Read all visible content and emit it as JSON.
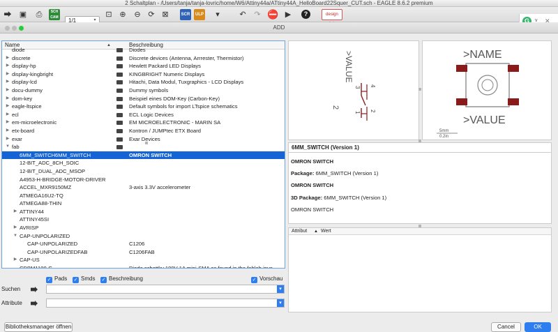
{
  "window_title": "2 Schaltplan - /Users/tanja/tanja-lovric/home/W6/Attiny44a/ATtiny44A_HelloBoard22Squer_CUT.sch - EAGLE 8.6.2 premium",
  "toolbar": {
    "sheet": "1/1",
    "icons": [
      "open-icon",
      "save-icon",
      "print-icon",
      "cam-icon",
      "sheet-select",
      "zoom-fit-icon",
      "zoom-in-icon",
      "zoom-out-icon",
      "zoom-redraw-icon",
      "zoom-select-icon",
      "scr-icon",
      "ulp-icon",
      "undo-icon",
      "redo-icon",
      "stop-icon",
      "go-icon",
      "help-icon",
      "eagle-logo"
    ],
    "brand_label": "design link",
    "version": "v"
  },
  "dialog": {
    "title": "ADD"
  },
  "tree": {
    "col_name": "Name",
    "col_desc": "Beschreibung",
    "rows": [
      {
        "name": "diode",
        "desc": "Diodes",
        "arrow": "",
        "lib": true,
        "indent": 0
      },
      {
        "name": "discrete",
        "desc": "Discrete devices (Antenna, Arrrester, Thermistor)",
        "arrow": "▶",
        "lib": true,
        "indent": 0
      },
      {
        "name": "display-hp",
        "desc": "Hewlett Packard LED Displays",
        "arrow": "▶",
        "lib": true,
        "indent": 0
      },
      {
        "name": "display-kingbright",
        "desc": "KINGBRIGHT Numeric Displays",
        "arrow": "▶",
        "lib": true,
        "indent": 0
      },
      {
        "name": "display-lcd",
        "desc": "Hitachi, Data Modul, Tuxgraphics - LCD Displays",
        "arrow": "▶",
        "lib": true,
        "indent": 0
      },
      {
        "name": "docu-dummy",
        "desc": "Dummy symbols",
        "arrow": "▶",
        "lib": true,
        "indent": 0
      },
      {
        "name": "dom-key",
        "desc": "Beispiel eines DOM-Key (Carbon-Key)",
        "arrow": "▶",
        "lib": true,
        "indent": 0
      },
      {
        "name": "eagle-ltspice",
        "desc": "Default symbols for import LTspice schematics",
        "arrow": "▶",
        "lib": true,
        "indent": 0
      },
      {
        "name": "ecl",
        "desc": "ECL Logic Devices",
        "arrow": "▶",
        "lib": true,
        "indent": 0
      },
      {
        "name": "em-microelectronic",
        "desc": "EM MICROELECTRONIC - MARIN SA",
        "arrow": "▶",
        "lib": true,
        "indent": 0
      },
      {
        "name": "etx-board",
        "desc": "Kontron / JUMPtec ETX Board",
        "arrow": "▶",
        "lib": true,
        "indent": 0
      },
      {
        "name": "exar",
        "desc": "Exar Devices",
        "arrow": "▶",
        "lib": true,
        "indent": 0
      },
      {
        "name": "fab",
        "desc": "",
        "arrow": "▼",
        "lib": true,
        "indent": 0
      },
      {
        "name": "6MM_SWITCH6MM_SWITCH",
        "desc": "OMRON SWITCH",
        "arrow": "",
        "lib": false,
        "indent": 1,
        "selected": true
      },
      {
        "name": "12-BIT_ADC_8CH_SOIC",
        "desc": "",
        "arrow": "",
        "lib": false,
        "indent": 1
      },
      {
        "name": "12-BIT_DUAL_ADC_MSOP",
        "desc": "",
        "arrow": "",
        "lib": false,
        "indent": 1
      },
      {
        "name": "A4953-H-BRIDGE-MOTOR-DRIVER",
        "desc": "",
        "arrow": "",
        "lib": false,
        "indent": 1
      },
      {
        "name": "ACCEL_MXR9150MZ",
        "desc": "3-axis 3.3V accelerometer",
        "arrow": "",
        "lib": false,
        "indent": 1
      },
      {
        "name": "ATMEGA16U2-TQ",
        "desc": "",
        "arrow": "",
        "lib": false,
        "indent": 1
      },
      {
        "name": "ATMEGA88-THIN",
        "desc": "",
        "arrow": "",
        "lib": false,
        "indent": 1
      },
      {
        "name": "ATTINY44",
        "desc": "",
        "arrow": "▶",
        "lib": false,
        "indent": 1
      },
      {
        "name": "ATTINY45SI",
        "desc": "",
        "arrow": "",
        "lib": false,
        "indent": 1
      },
      {
        "name": "AVRISP",
        "desc": "",
        "arrow": "▶",
        "lib": false,
        "indent": 1
      },
      {
        "name": "CAP-UNPOLARIZED",
        "desc": "",
        "arrow": "▼",
        "lib": false,
        "indent": 1
      },
      {
        "name": "CAP-UNPOLARIZED",
        "desc": "C1206",
        "arrow": "",
        "lib": false,
        "indent": 2
      },
      {
        "name": "CAP-UNPOLARIZEDFAB",
        "desc": "C1206FAB",
        "arrow": "",
        "lib": false,
        "indent": 2
      },
      {
        "name": "CAP-US",
        "desc": "",
        "arrow": "▶",
        "lib": false,
        "indent": 1
      },
      {
        "name": "CDBM1100-G",
        "desc": "Diode schottky 100V 1A mini-SMA as found in the fablab inve",
        "arrow": "",
        "lib": false,
        "indent": 1
      }
    ]
  },
  "options": {
    "pads": "Pads",
    "smds": "Smds",
    "desc": "Beschreibung",
    "preview": "Vorschau"
  },
  "search": {
    "label": "Suchen",
    "value": ""
  },
  "attribute": {
    "label": "Attribute",
    "value": ""
  },
  "buttons": {
    "library_manager": "Bibliotheksmanager öffnen",
    "cancel": "Cancel",
    "ok": "OK"
  },
  "symbol": {
    "value_label": ">VALUE",
    "pin_1": "1",
    "pin_2": "2",
    "pin_3": "3",
    "pin_4": "4",
    "part_number": "2"
  },
  "package": {
    "name_label": ">NAME",
    "value_label": ">VALUE",
    "scale_mm": "5mm",
    "scale_in": "0.2in"
  },
  "info": {
    "header": "6MM_SWITCH (Version 1)",
    "line1": "OMRON SWITCH",
    "package_label": "Package:",
    "package_value": "6MM_SWITCH (Version 1)",
    "line2": "OMRON SWITCH",
    "pkg3d_label": "3D Package:",
    "pkg3d_value": "6MM_SWITCH (Version 1)",
    "line3": "OMRON SWITCH"
  },
  "attr_table": {
    "col_attr": "Attribut",
    "col_value": "Wert"
  },
  "colors": {
    "selection": "#1564d6",
    "accent": "#2f7ef0",
    "pad": "#8b1a1a"
  }
}
